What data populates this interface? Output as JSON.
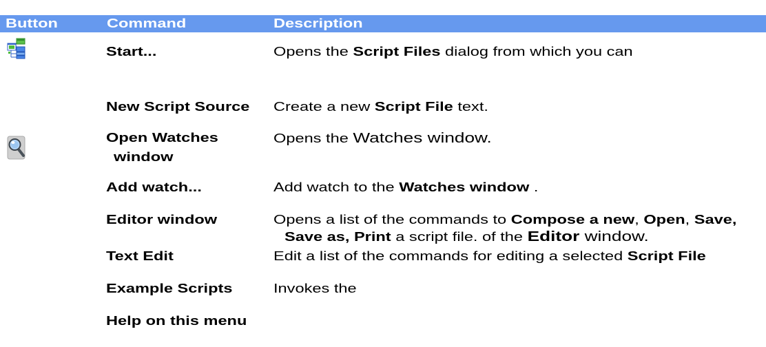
{
  "colors": {
    "header_background": "#6699ee",
    "header_text": "#ffffff",
    "body_text": "#000000"
  },
  "header": {
    "button": "Button",
    "command": "Command",
    "description": "Description"
  },
  "rows": [
    {
      "icon": "script-files-icon",
      "command": [
        "Start..."
      ],
      "description": [
        [
          {
            "text": "Opens the ",
            "bold": false
          },
          {
            "text": "Script Files",
            "bold": true
          },
          {
            "text": " dialog from which you can",
            "bold": false
          }
        ]
      ]
    },
    {
      "icon": null,
      "command": [
        "New Script Source"
      ],
      "description": [
        [
          {
            "text": "Create a new ",
            "bold": false
          },
          {
            "text": "Script File",
            "bold": true
          },
          {
            "text": " text.",
            "bold": false
          }
        ]
      ]
    },
    {
      "icon": "magnifier-icon",
      "command": [
        "Open Watches",
        "window"
      ],
      "description": [
        [
          {
            "text": "Opens the ",
            "bold": false
          },
          {
            "text": "Watches window.",
            "bold": false
          }
        ]
      ]
    },
    {
      "icon": null,
      "command": [
        "Add watch..."
      ],
      "description": [
        [
          {
            "text": "Add watch to the ",
            "bold": false
          },
          {
            "text": "Watches window",
            "bold": true
          },
          {
            "text": " .",
            "bold": false
          }
        ]
      ]
    },
    {
      "icon": null,
      "command": [
        "Editor window"
      ],
      "description": [
        [
          {
            "text": "Opens a list of the commands to ",
            "bold": false
          },
          {
            "text": "Compose a new",
            "bold": true
          },
          {
            "text": ", ",
            "bold": false
          },
          {
            "text": "Open",
            "bold": true
          },
          {
            "text": ", ",
            "bold": false
          },
          {
            "text": "Save,",
            "bold": true
          }
        ],
        [
          {
            "text": "Save as, Print",
            "bold": true
          },
          {
            "text": " a script file. of the ",
            "bold": false
          },
          {
            "text": "Editor",
            "bold": true
          },
          {
            "text": " window.",
            "bold": false
          }
        ]
      ]
    },
    {
      "icon": null,
      "command": [
        "Text Edit"
      ],
      "description": [
        [
          {
            "text": "Edit a list of the commands for editing a selected ",
            "bold": false
          },
          {
            "text": "Script File",
            "bold": true
          }
        ]
      ]
    },
    {
      "icon": null,
      "command": [
        "Example Scripts"
      ],
      "description": [
        [
          {
            "text": "Invokes the",
            "bold": false
          }
        ]
      ]
    },
    {
      "icon": null,
      "command": [
        "Help on this menu"
      ],
      "description": []
    }
  ]
}
